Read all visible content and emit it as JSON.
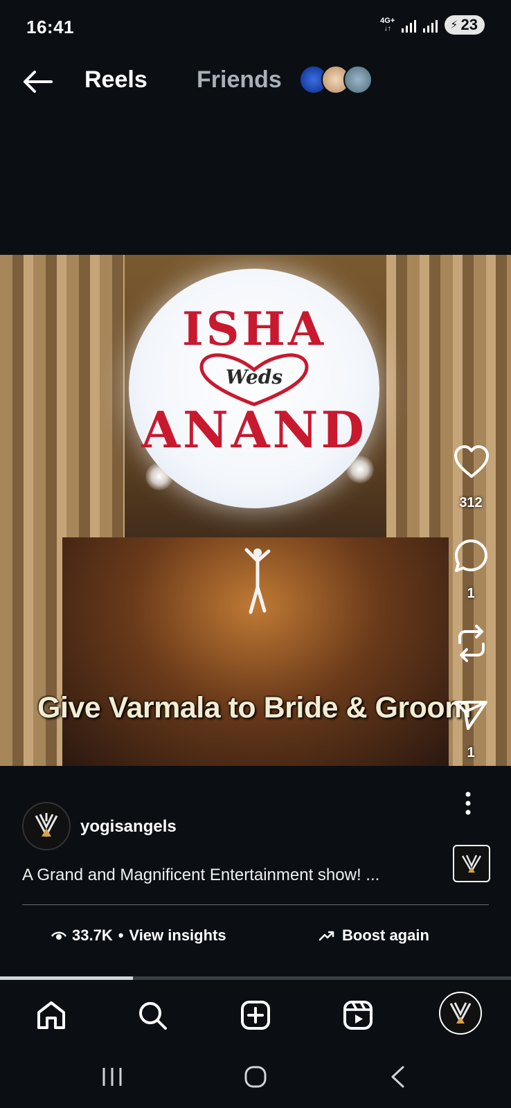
{
  "status_bar": {
    "time": "16:41",
    "network": "4G+",
    "battery": "23"
  },
  "header": {
    "title": "Reels",
    "friends_label": "Friends"
  },
  "video": {
    "balloon_top": "ISHA",
    "balloon_middle": "Weds",
    "balloon_bottom": "ANAND",
    "overlay_caption": "Give Varmala to Bride & Groom",
    "progress": 0.26
  },
  "actions": {
    "likes": "312",
    "comments": "1",
    "shares": "1"
  },
  "post": {
    "username": "yogisangels",
    "caption": "A Grand and Magnificent Entertainment show! ...",
    "views": "33.7K",
    "insights_label": "View insights",
    "boost_label": "Boost again"
  },
  "colors": {
    "background": "#0b0f14",
    "accent_red": "#c8192f",
    "muted": "#a8b0b8"
  },
  "icons": [
    "back-arrow-icon",
    "heart-icon",
    "comment-icon",
    "repost-icon",
    "send-icon",
    "more-icon",
    "eye-icon",
    "trending-icon",
    "home-icon",
    "search-icon",
    "create-icon",
    "reels-icon",
    "profile-avatar",
    "recents-icon",
    "home-gesture-icon",
    "back-gesture-icon"
  ]
}
